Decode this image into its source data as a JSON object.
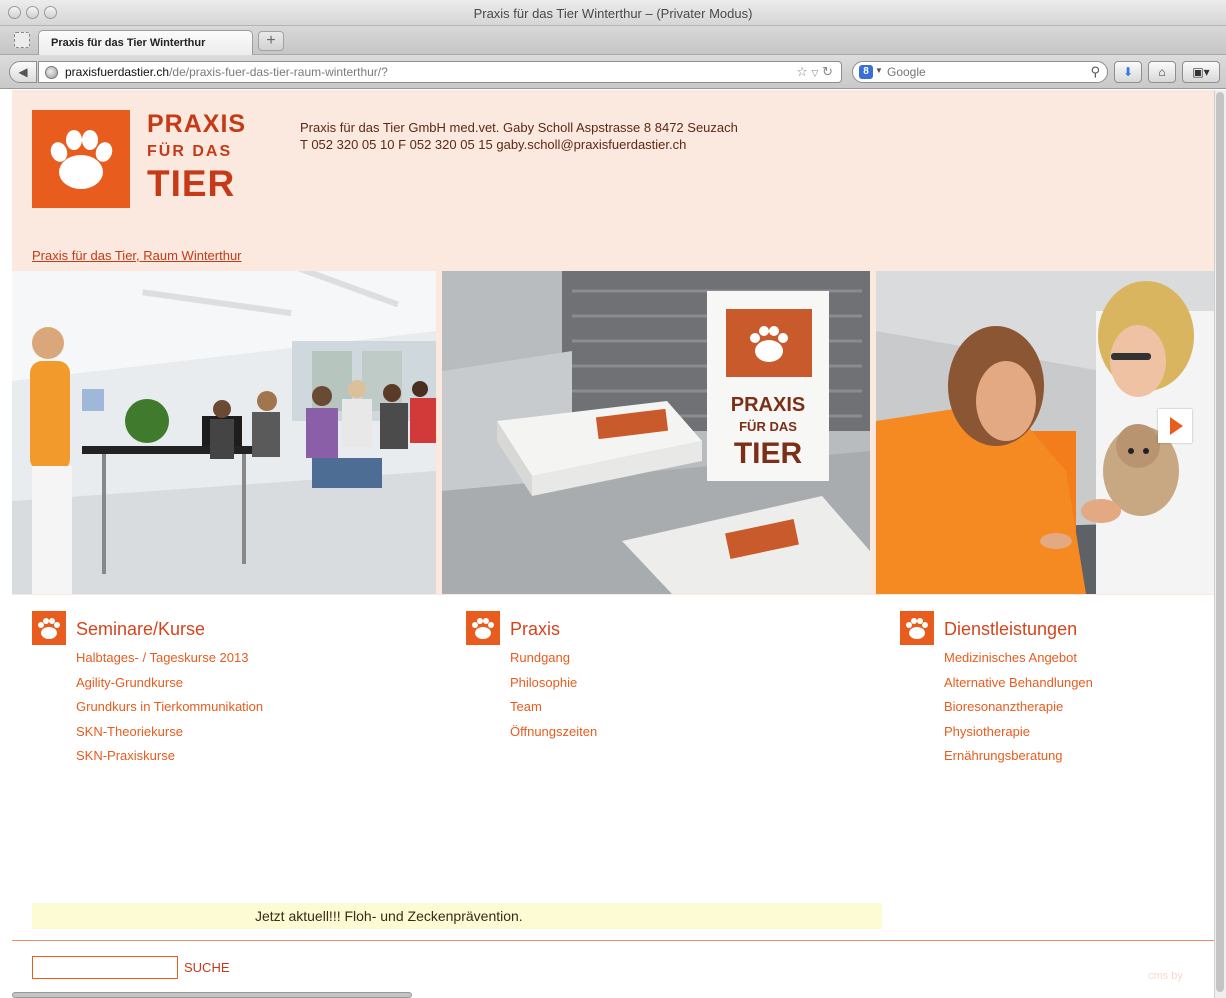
{
  "window": {
    "title": "Praxis für das Tier Winterthur – (Privater Modus)"
  },
  "tabs": [
    {
      "label": "Praxis für das Tier Winterthur"
    }
  ],
  "toolbar": {
    "url_host": "praxisfuerdastier.ch",
    "url_path": "/de/praxis-fuer-das-tier-raum-winterthur/?",
    "search_placeholder": "Google"
  },
  "header": {
    "logo": {
      "line1": "PRAXIS",
      "line2": "FÜR DAS",
      "line3": "TIER"
    },
    "contact_line1": "Praxis für das Tier GmbH med.vet. Gaby Scholl Aspstrasse 8 8472 Seuzach",
    "contact_line2": "T 052 320 05 10 F 052 320 05 15 gaby.scholl@praxisfuerdastier.ch",
    "breadcrumb": "Praxis für das Tier, Raum Winterthur"
  },
  "slider_photo_texts": {
    "card_line1": "PRAXIS",
    "card_line2": "FÜR DAS",
    "card_line3": "TIER"
  },
  "columns": [
    {
      "title": "Seminare/Kurse",
      "items": [
        "Halbtages- / Tageskurse 2013",
        "Agility-Grundkurse",
        "Grundkurs in Tierkommunikation",
        "SKN-Theoriekurse",
        "SKN-Praxiskurse"
      ]
    },
    {
      "title": "Praxis",
      "items": [
        "Rundgang",
        "Philosophie",
        "Team",
        "Öffnungszeiten"
      ]
    },
    {
      "title": "Dienstleistungen",
      "items": [
        "Medizinisches Angebot",
        "Alternative Behandlungen",
        "Bioresonanztherapie",
        "Physiotherapie",
        "Ernährungsberatung"
      ]
    }
  ],
  "news": {
    "text": "Jetzt aktuell!!! Floh- und Zeckenprävention."
  },
  "footer": {
    "search_value": "",
    "search_label": "SUCHE",
    "cms_label": "cms by"
  },
  "colors": {
    "brand_orange": "#e85c1e",
    "brand_dark": "#c53a17",
    "header_bg": "#fbe8df",
    "news_bg": "#fdfbd3"
  },
  "icons": [
    "paw-icon",
    "globe-icon",
    "star-icon",
    "reload-icon",
    "search-icon",
    "download-icon",
    "home-icon",
    "addons-icon",
    "next-arrow-icon"
  ]
}
